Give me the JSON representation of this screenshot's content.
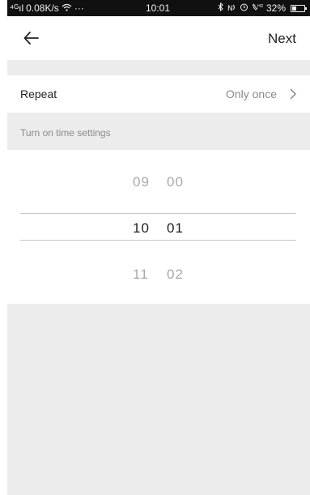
{
  "status_bar": {
    "signal": "⁴ᴳıl",
    "speed": "0.08K/s",
    "more": "···",
    "time": "10:01",
    "icons": [
      "bluetooth-icon",
      "nfc-icon",
      "alarm-icon",
      "hd-call-icon"
    ],
    "battery": "32%"
  },
  "nav": {
    "next_label": "Next"
  },
  "repeat": {
    "label": "Repeat",
    "value": "Only once"
  },
  "section": {
    "label": "Turn on time settings"
  },
  "picker": {
    "rows": [
      {
        "hour": "09",
        "minute": "00",
        "state": "dim"
      },
      {
        "hour": "10",
        "minute": "01",
        "state": "selected"
      },
      {
        "hour": "11",
        "minute": "02",
        "state": "dim"
      }
    ]
  }
}
